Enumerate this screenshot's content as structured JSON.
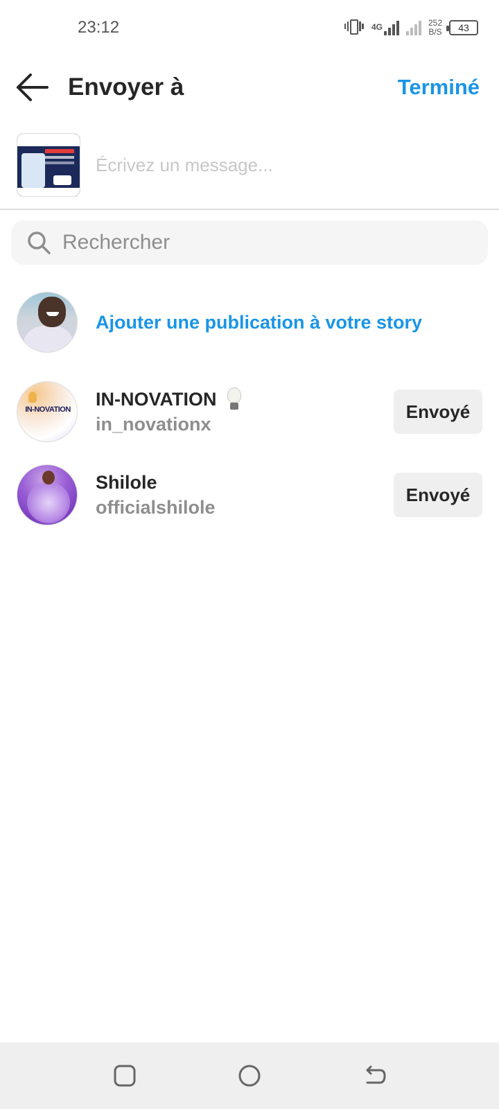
{
  "status_bar": {
    "time": "23:12",
    "network_type": "4G",
    "speed_value": "252",
    "speed_unit": "B/S",
    "battery": "43",
    "icons": [
      "vibrate-icon",
      "signal-icon",
      "signal-icon",
      "battery-icon"
    ]
  },
  "header": {
    "title": "Envoyer à",
    "done_label": "Terminé",
    "back_icon": "arrow-left-icon"
  },
  "composer": {
    "message_placeholder": "Écrivez un message...",
    "message_value": ""
  },
  "search": {
    "placeholder": "Rechercher",
    "value": "",
    "icon": "search-icon"
  },
  "story": {
    "label": "Ajouter une publication à votre story"
  },
  "contacts": [
    {
      "name": "IN-NOVATION",
      "emoji": "light-bulb-icon",
      "handle": "in_novationx",
      "action_label": "Envoyé",
      "avatar_text": "IN-NOVATION"
    },
    {
      "name": "Shilole",
      "handle": "officialshilole",
      "action_label": "Envoyé"
    }
  ],
  "nav_bar": {
    "icons": [
      "recent-apps-icon",
      "home-icon",
      "back-icon"
    ]
  },
  "colors": {
    "accent": "#1a95e6",
    "text_primary": "#262626",
    "text_secondary": "#8e8e8e",
    "button_bg": "#efefef"
  }
}
